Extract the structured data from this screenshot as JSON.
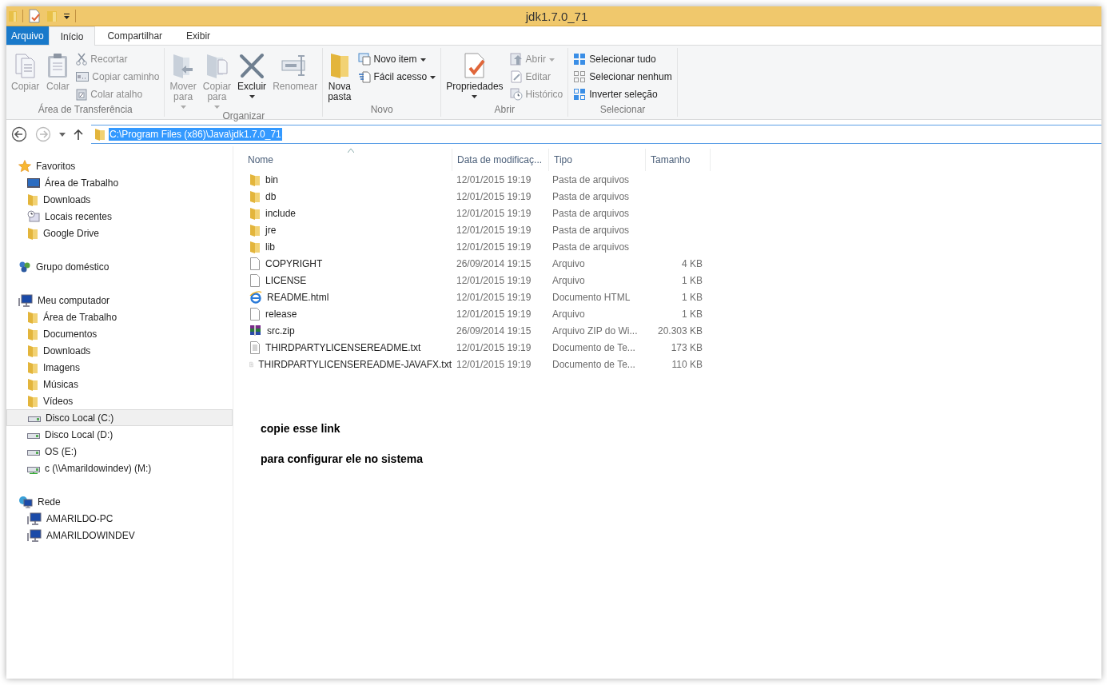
{
  "window": {
    "title": "jdk1.7.0_71"
  },
  "ribbon_tabs": [
    {
      "label": "Arquivo",
      "kind": "file",
      "selected": false
    },
    {
      "label": "Início",
      "kind": "tab",
      "selected": true
    },
    {
      "label": "Compartilhar",
      "kind": "tab",
      "selected": false
    },
    {
      "label": "Exibir",
      "kind": "tab",
      "selected": false
    }
  ],
  "ribbon_groups": [
    {
      "label": "Área de Transferência",
      "items": [
        {
          "label": "Copiar",
          "kind": "large",
          "disabled": true,
          "dropdown": false
        },
        {
          "label": "Colar",
          "kind": "large",
          "disabled": true,
          "dropdown": false
        },
        {
          "label": "Recortar",
          "kind": "small",
          "disabled": true,
          "dropdown": false
        },
        {
          "label": "Copiar caminho",
          "kind": "small",
          "disabled": true,
          "dropdown": false
        },
        {
          "label": "Colar atalho",
          "kind": "small",
          "disabled": true,
          "dropdown": false
        }
      ]
    },
    {
      "label": "Organizar",
      "items": [
        {
          "label": "Mover para",
          "kind": "large",
          "disabled": true,
          "dropdown": true
        },
        {
          "label": "Copiar para",
          "kind": "large",
          "disabled": true,
          "dropdown": true
        },
        {
          "label": "Excluir",
          "kind": "large",
          "disabled": false,
          "dropdown": true
        },
        {
          "label": "Renomear",
          "kind": "large",
          "disabled": true,
          "dropdown": false
        }
      ]
    },
    {
      "label": "Novo",
      "items": [
        {
          "label": "Nova pasta",
          "kind": "large",
          "disabled": false,
          "dropdown": false
        },
        {
          "label": "Novo item",
          "kind": "small",
          "disabled": false,
          "dropdown": true
        },
        {
          "label": "Fácil acesso",
          "kind": "small",
          "disabled": false,
          "dropdown": true
        }
      ]
    },
    {
      "label": "Abrir",
      "items": [
        {
          "label": "Propriedades",
          "kind": "large",
          "disabled": false,
          "dropdown": true
        },
        {
          "label": "Abrir",
          "kind": "small",
          "disabled": true,
          "dropdown": true
        },
        {
          "label": "Editar",
          "kind": "small",
          "disabled": true,
          "dropdown": false
        },
        {
          "label": "Histórico",
          "kind": "small",
          "disabled": true,
          "dropdown": false
        }
      ]
    },
    {
      "label": "Selecionar",
      "items": [
        {
          "label": "Selecionar tudo",
          "kind": "small",
          "disabled": false,
          "dropdown": false
        },
        {
          "label": "Selecionar nenhum",
          "kind": "small",
          "disabled": false,
          "dropdown": false
        },
        {
          "label": "Inverter seleção",
          "kind": "small",
          "disabled": false,
          "dropdown": false
        }
      ]
    }
  ],
  "address": {
    "path": "C:\\Program Files (x86)\\Java\\jdk1.7.0_71",
    "selected": true
  },
  "sidebar": [
    {
      "label": "Favoritos",
      "kind": "favorites",
      "children": [
        {
          "label": "Área de Trabalho",
          "kind": "desktop",
          "selected": false
        },
        {
          "label": "Downloads",
          "kind": "folder",
          "selected": false
        },
        {
          "label": "Locais recentes",
          "kind": "recent",
          "selected": false
        },
        {
          "label": "Google Drive",
          "kind": "folder",
          "selected": false
        }
      ]
    },
    {
      "label": "Grupo doméstico",
      "kind": "homegroup"
    },
    {
      "label": "Meu computador",
      "kind": "computer",
      "children": [
        {
          "label": "Área de Trabalho",
          "kind": "folder",
          "selected": false
        },
        {
          "label": "Documentos",
          "kind": "folder",
          "selected": false
        },
        {
          "label": "Downloads",
          "kind": "folder",
          "selected": false
        },
        {
          "label": "Imagens",
          "kind": "folder",
          "selected": false
        },
        {
          "label": "Músicas",
          "kind": "folder",
          "selected": false
        },
        {
          "label": "Vídeos",
          "kind": "folder",
          "selected": false
        },
        {
          "label": "Disco Local (C:)",
          "kind": "drive",
          "selected": true
        },
        {
          "label": "Disco Local (D:)",
          "kind": "drive",
          "selected": false
        },
        {
          "label": "OS (E:)",
          "kind": "drive",
          "selected": false
        },
        {
          "label": "c (\\\\Amarildowindev) (M:)",
          "kind": "netdrive",
          "selected": false
        }
      ]
    },
    {
      "label": "Rede",
      "kind": "network",
      "children": [
        {
          "label": "AMARILDO-PC",
          "kind": "pc",
          "selected": false
        },
        {
          "label": "AMARILDOWINDEV",
          "kind": "pc",
          "selected": false
        }
      ]
    }
  ],
  "table": {
    "columns": [
      {
        "label": "Nome",
        "sorted": true
      },
      {
        "label": "Data de modificaç...",
        "sorted": false
      },
      {
        "label": "Tipo",
        "sorted": false
      },
      {
        "label": "Tamanho",
        "sorted": false
      }
    ],
    "rows": [
      {
        "name": "bin",
        "date": "12/01/2015 19:19",
        "type": "Pasta de arquivos",
        "kind": "folder"
      },
      {
        "name": "db",
        "date": "12/01/2015 19:19",
        "type": "Pasta de arquivos",
        "kind": "folder"
      },
      {
        "name": "include",
        "date": "12/01/2015 19:19",
        "type": "Pasta de arquivos",
        "kind": "folder"
      },
      {
        "name": "jre",
        "date": "12/01/2015 19:19",
        "type": "Pasta de arquivos",
        "kind": "folder"
      },
      {
        "name": "lib",
        "date": "12/01/2015 19:19",
        "type": "Pasta de arquivos",
        "kind": "folder"
      },
      {
        "name": "COPYRIGHT",
        "date": "26/09/2014 19:15",
        "type": "Arquivo",
        "size": "4 KB",
        "kind": "file"
      },
      {
        "name": "LICENSE",
        "date": "12/01/2015 19:19",
        "type": "Arquivo",
        "size": "1 KB",
        "kind": "file"
      },
      {
        "name": "README.html",
        "date": "12/01/2015 19:19",
        "type": "Documento HTML",
        "size": "1 KB",
        "kind": "html"
      },
      {
        "name": "release",
        "date": "12/01/2015 19:19",
        "type": "Arquivo",
        "size": "1 KB",
        "kind": "file"
      },
      {
        "name": "src.zip",
        "date": "26/09/2014 19:15",
        "type": "Arquivo ZIP do Wi...",
        "size": "20.303 KB",
        "kind": "zip"
      },
      {
        "name": "THIRDPARTYLICENSEREADME.txt",
        "date": "12/01/2015 19:19",
        "type": "Documento de Te...",
        "size": "173 KB",
        "kind": "text"
      },
      {
        "name": "THIRDPARTYLICENSEREADME-JAVAFX.txt",
        "date": "12/01/2015 19:19",
        "type": "Documento de Te...",
        "size": "110 KB",
        "kind": "text"
      }
    ]
  },
  "notes": [
    "copie esse link",
    "para configurar ele no sistema"
  ]
}
